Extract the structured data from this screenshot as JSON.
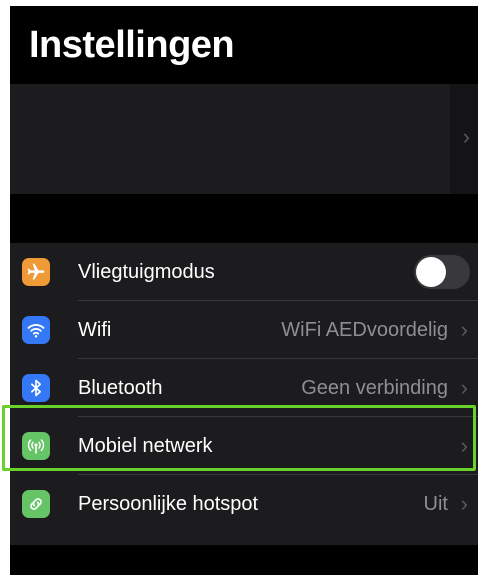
{
  "header": {
    "title": "Instellingen"
  },
  "account_card": {
    "chevron": "›"
  },
  "settings": [
    {
      "id": "vliegtuigmodus",
      "label": "Vliegtuigmodus",
      "icon": "airplane-icon",
      "icon_color": "#f09a37",
      "toggle": false
    },
    {
      "id": "wifi",
      "label": "Wifi",
      "value": "WiFi AEDvoordelig",
      "icon": "wifi-icon",
      "icon_color": "#3478f6",
      "chevron": "›"
    },
    {
      "id": "bluetooth",
      "label": "Bluetooth",
      "value": "Geen verbinding",
      "icon": "bluetooth-icon",
      "icon_color": "#3478f6",
      "chevron": "›"
    },
    {
      "id": "mobiel-netwerk",
      "label": "Mobiel netwerk",
      "value": "",
      "icon": "antenna-icon",
      "icon_color": "#65c466",
      "chevron": "›",
      "highlighted": true,
      "highlight_color": "#6ad02a"
    },
    {
      "id": "persoonlijke-hotspot",
      "label": "Persoonlijke hotspot",
      "value": "Uit",
      "icon": "hotspot-icon",
      "icon_color": "#65c466",
      "chevron": "›"
    }
  ]
}
